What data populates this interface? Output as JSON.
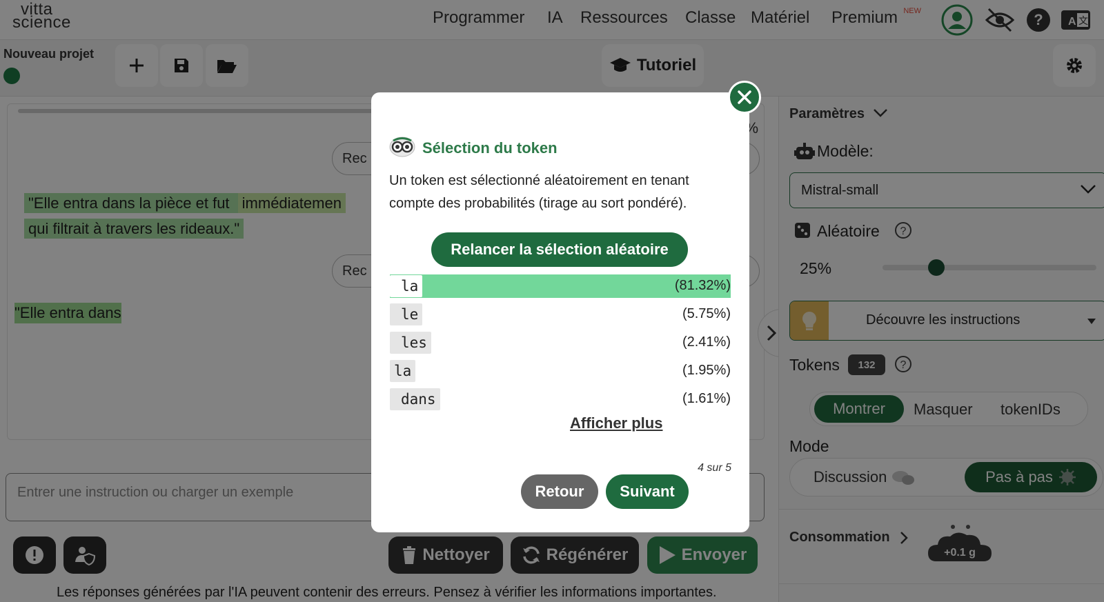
{
  "brand": {
    "line1": "vitta",
    "line2": "science"
  },
  "nav": {
    "links": [
      "Programmer",
      "IA",
      "Ressources",
      "Classe",
      "Matériel",
      "Premium"
    ],
    "premium_badge": "NEW"
  },
  "toolbar": {
    "project_name": "Nouveau projet",
    "tutorial_label": "Tutoriel"
  },
  "chat": {
    "percent_fragment": "%",
    "button_fragment": "Rec",
    "message1_part1": "\"Elle entra dans la pièce et fut ",
    "message1_part2": "immédiatemen",
    "message1_line2": "qui filtrait à travers les rideaux.\"",
    "message2": "\"Elle entra dans",
    "input_placeholder": "Entrer une instruction ou charger un exemple",
    "actions": {
      "clean": "Nettoyer",
      "regenerate": "Régénérer",
      "send": "Envoyer"
    },
    "footer_note": "Les réponses générées par l'IA peuvent contenir des erreurs. Pensez à vérifier les informations importantes."
  },
  "panel": {
    "params_title": "Paramètres",
    "model_label": "Modèle:",
    "model_value": "Mistral-small",
    "random_label": "Aléatoire",
    "random_value": "25%",
    "random_fraction": 0.25,
    "instructions_label": "Découvre les instructions",
    "tokens_label": "Tokens",
    "tokens_count": "132",
    "token_view_options": [
      "Montrer",
      "Masquer",
      "tokenIDs"
    ],
    "mode_label": "Mode",
    "mode_options": [
      "Discussion",
      "Pas à pas"
    ],
    "consumption_label": "Consommation",
    "consumption_value": "+0.1 g"
  },
  "modal": {
    "title": "Sélection du token",
    "description": "Un token est sélectionné aléatoirement en tenant compte des probabilités (tirage au sort pondéré).",
    "reroll_label": "Relancer la sélection aléatoire",
    "tokens": [
      {
        "token": " la",
        "percent": "(81.32%)",
        "probability": 81.32
      },
      {
        "token": " le",
        "percent": "(5.75%)",
        "probability": 5.75
      },
      {
        "token": " les",
        "percent": "(2.41%)",
        "probability": 2.41
      },
      {
        "token": "la",
        "percent": "(1.95%)",
        "probability": 1.95
      },
      {
        "token": " dans",
        "percent": "(1.61%)",
        "probability": 1.61
      }
    ],
    "show_more": "Afficher plus",
    "step": "4 sur 5",
    "back_label": "Retour",
    "next_label": "Suivant"
  }
}
